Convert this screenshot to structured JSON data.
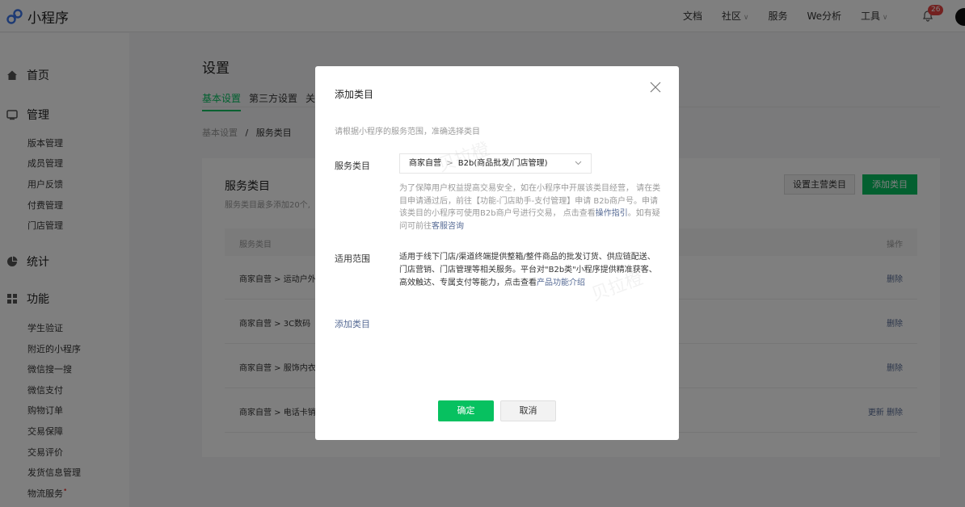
{
  "app": {
    "name": "小程序"
  },
  "topnav": {
    "docs": "文档",
    "community": "社区",
    "service": "服务",
    "we_analysis": "We分析",
    "tools": "工具",
    "notification_count": "26"
  },
  "sidebar": {
    "home": "首页",
    "manage": "管理",
    "manage_items": [
      "版本管理",
      "成员管理",
      "用户反馈",
      "付费管理",
      "门店管理"
    ],
    "stats": "统计",
    "features": "功能",
    "feature_items": [
      "学生验证",
      "附近的小程序",
      "微信搜一搜",
      "微信支付",
      "购物订单",
      "交易保障",
      "交易评价",
      "发货信息管理",
      "物流服务"
    ],
    "logistics_marker": "•"
  },
  "page": {
    "title": "设置",
    "tabs": [
      "基本设置",
      "第三方设置",
      "关"
    ],
    "breadcrumb_root": "基本设置",
    "breadcrumb_sep": "/",
    "breadcrumb_current": "服务类目"
  },
  "card": {
    "title": "服务类目",
    "subtitle": "服务类目最多添加20个,",
    "set_main_button": "设置主营类目",
    "add_button": "添加类目",
    "col_category": "服务类目",
    "col_action": "操作",
    "rows": [
      {
        "category": "商家自营 > 运动户外",
        "actions": "删除"
      },
      {
        "category": "商家自营 > 3C数码",
        "actions": "删除"
      },
      {
        "category": "商家自营 > 服饰内衣",
        "actions": "删除"
      },
      {
        "category": "商家自营 > 电话卡销",
        "actions": "更新 删除"
      }
    ]
  },
  "modal": {
    "title": "添加类目",
    "tip": "请根据小程序的服务范围，准确选择类目",
    "service_category_label": "服务类目",
    "select_level1": "商家自营",
    "select_sep": ">",
    "select_level2": "B2b(商品批发/门店管理)",
    "desc_text": "为了保障用户权益提高交易安全，如在小程序中开展该类目经营， 请在类目申请通过后，前往【功能-门店助手-支付管理】申请 B2b商户号。申请该类目的小程序可使用B2b商户号进行交易， 点击查看",
    "desc_link1": "操作指引",
    "desc_mid": "。如有疑问可前往",
    "desc_link2": "客服咨询",
    "scope_label": "适用范围",
    "scope_text": "适用于线下门店/渠道终端提供整箱/整件商品的批发订货、供应链配送、门店营销、门店管理等相关服务。平台对\"B2b类\"小程序提供精准获客、高效触达、专属支付等能力，点击查看",
    "scope_link": "产品功能介绍",
    "add_category_link": "添加类目",
    "confirm_button": "确定",
    "cancel_button": "取消"
  },
  "watermark": "贝拉橙",
  "colors": {
    "primary_green": "#07c160",
    "link_blue": "#576b95",
    "badge_red": "#e64340"
  }
}
